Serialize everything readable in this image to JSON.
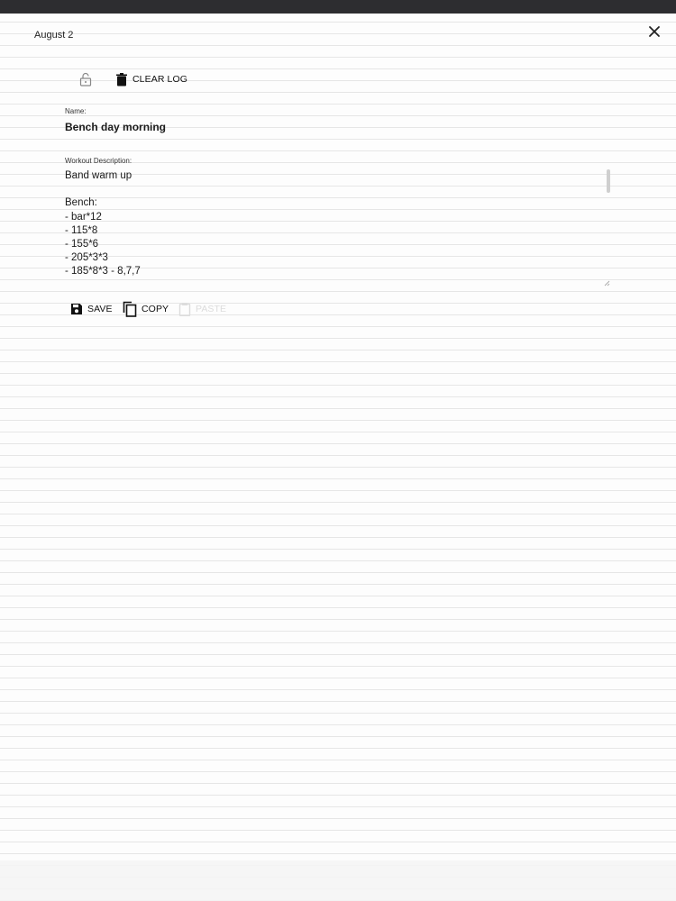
{
  "status_bar": {},
  "header": {
    "date": "August 2"
  },
  "toolbar": {
    "clear_label": "CLEAR LOG"
  },
  "form": {
    "name_label": "Name:",
    "name_value": "Bench day morning",
    "description_label": "Workout Description:",
    "description_value": "Band warm up\n\nBench:\n- bar*12\n- 115*8\n- 155*6\n- 205*3*3\n- 185*8*3 - 8,7,7"
  },
  "actions": {
    "save_label": "SAVE",
    "copy_label": "COPY",
    "paste_label": "PASTE",
    "paste_enabled": false
  },
  "icons": {
    "close": "close-icon",
    "lock": "lock-open-icon",
    "clear": "trash-icon",
    "save": "floppy-disk-icon",
    "copy": "copy-icon",
    "paste": "clipboard-icon"
  }
}
